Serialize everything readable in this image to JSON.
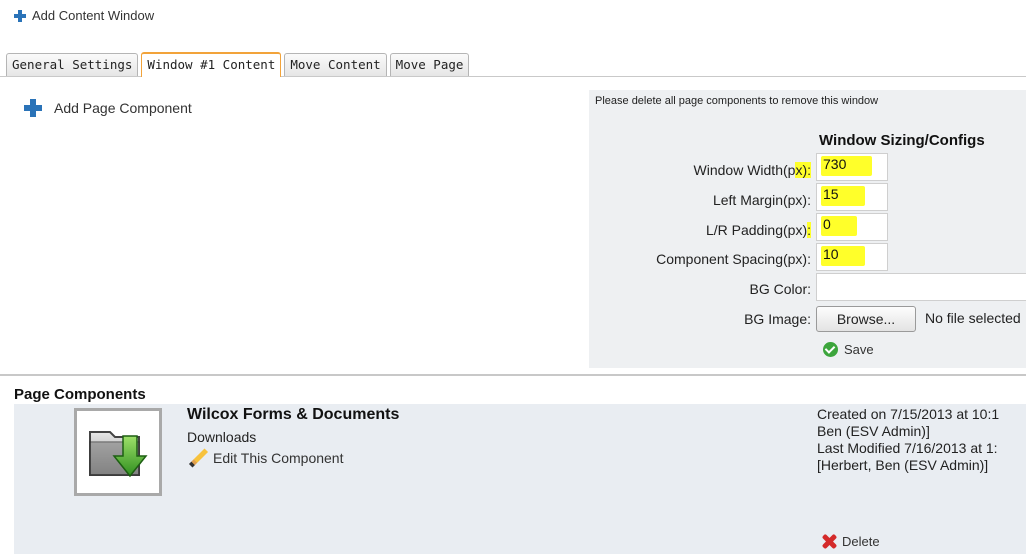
{
  "add_window": {
    "label": "Add Content Window",
    "icon": "plus-icon"
  },
  "tabs": [
    {
      "label": "General Settings",
      "active": false
    },
    {
      "label": "Window #1 Content",
      "active": true
    },
    {
      "label": "Move Content",
      "active": false
    },
    {
      "label": "Move Page",
      "active": false
    }
  ],
  "add_component": {
    "label": "Add Page Component",
    "icon": "plus-icon"
  },
  "config": {
    "notice": "Please delete all page components to remove this window",
    "title": "Window Sizing/Configs",
    "window_width": {
      "label_main": "Window Width(p",
      "label_hl": "x):",
      "value": "730"
    },
    "left_margin": {
      "label_main": "Left Margin(px):",
      "value": "15"
    },
    "lr_padding": {
      "label_main": "L/R Padding(px)",
      "label_hl": ":",
      "value": "0"
    },
    "component_spacing": {
      "label_main": "Component Spacing(px):",
      "value": "10"
    },
    "bg_color": {
      "label": "BG Color:",
      "value": ""
    },
    "bg_image": {
      "label": "BG Image:",
      "button": "Browse...",
      "status": "No file selected"
    },
    "save_label": "Save",
    "highlight_color": "#ffff2a"
  },
  "page_components": {
    "title": "Page Components",
    "items": [
      {
        "name": "Wilcox Forms & Documents",
        "type": "Downloads",
        "edit_label": "Edit This Component",
        "icon": "download-folder-icon",
        "meta_lines": [
          "Created on 7/15/2013 at 10:1",
          "Ben (ESV Admin)]",
          "Last Modified 7/16/2013 at 1:",
          "[Herbert, Ben (ESV Admin)]"
        ],
        "delete_label": "Delete"
      }
    ]
  }
}
